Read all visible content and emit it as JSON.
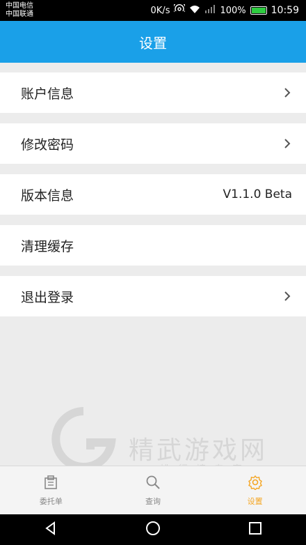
{
  "status": {
    "carrier1": "中国电信",
    "carrier2": "中国联通",
    "speed": "0K/s",
    "battery": "100%",
    "time": "10:59"
  },
  "header": {
    "title": "设置"
  },
  "settings": {
    "account_info": "账户信息",
    "change_password": "修改密码",
    "version_label": "版本信息",
    "version_value": "V1.1.0 Beta",
    "clear_cache": "清理缓存",
    "logout": "退出登录"
  },
  "watermark": {
    "text": "精武游戏网",
    "sub": "排行榜专家"
  },
  "tabs": [
    {
      "label": "委托单"
    },
    {
      "label": "查询"
    },
    {
      "label": "设置"
    }
  ],
  "colors": {
    "primary": "#1aa0e8",
    "active": "#f5a623",
    "inactive": "#888888"
  }
}
